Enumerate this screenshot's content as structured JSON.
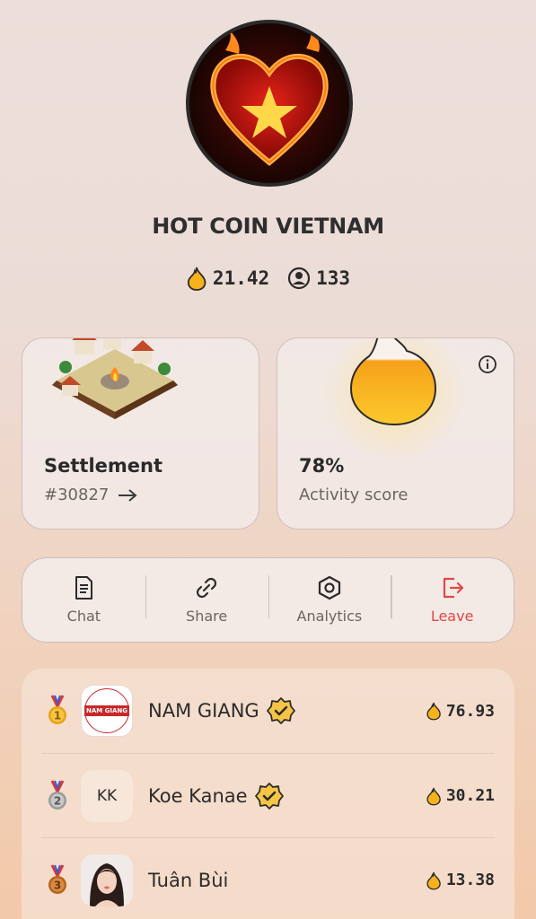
{
  "community": {
    "name": "HOT COIN VIETNAM",
    "balance": "21.42",
    "members": "133"
  },
  "cards": {
    "settlement": {
      "title": "Settlement",
      "id": "#30827"
    },
    "activity": {
      "value": "78%",
      "label": "Activity score"
    }
  },
  "actions": [
    {
      "label": "Chat",
      "icon": "document-icon"
    },
    {
      "label": "Share",
      "icon": "link-icon"
    },
    {
      "label": "Analytics",
      "icon": "hexagon-icon"
    },
    {
      "label": "Leave",
      "icon": "exit-icon"
    }
  ],
  "leaderboard": [
    {
      "rank": "1",
      "name": "NAM GIANG",
      "score": "76.93",
      "verified": true,
      "avatar_text": "NAM GIANG"
    },
    {
      "rank": "2",
      "name": "Koe Kanae",
      "score": "30.21",
      "verified": true,
      "avatar_text": "KK"
    },
    {
      "rank": "3",
      "name": "Tuân Bùi",
      "score": "13.38",
      "verified": false,
      "avatar_text": ""
    }
  ],
  "colors": {
    "flame": "#f6b21c",
    "leave": "#e04848",
    "gold": "#e8a317",
    "silver": "#9a9a9a",
    "bronze": "#b5651d"
  }
}
